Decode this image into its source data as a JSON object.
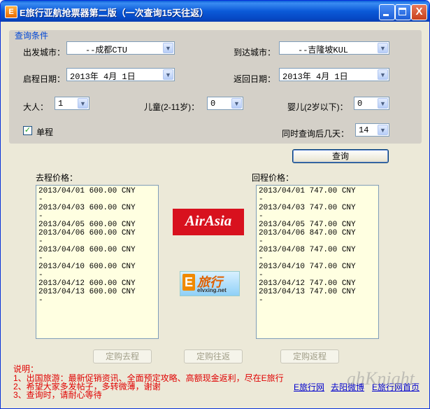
{
  "window": {
    "title": "E旅行亚航抢票器第二版（一次查询15天往返）",
    "icon_letter": "E",
    "close_glyph": "X"
  },
  "conditions": {
    "group_title": "查询条件",
    "depart_city_label": "出发城市：",
    "depart_city_value": "--成都CTU",
    "arrive_city_label": "到达城市：",
    "arrive_city_value": "--吉隆坡KUL",
    "depart_date_label": "启程日期：",
    "depart_date_value": "2013年 4月 1日",
    "return_date_label": "返回日期：",
    "return_date_value": "2013年 4月 1日",
    "adult_label": "大人：",
    "adult_value": "1",
    "child_label": "儿童(2-11岁)：",
    "child_value": "0",
    "infant_label": "婴儿(2岁以下)：",
    "infant_value": "0",
    "oneway_label": "单程",
    "oneway_checked": true,
    "days_label": "同时查询后几天：",
    "days_value": "14",
    "dropdown_glyph": "▼",
    "check_glyph": "✓"
  },
  "query_button": "查询",
  "outbound": {
    "label": "去程价格：",
    "lines": [
      "2013/04/01 600.00 CNY",
      "-",
      "2013/04/03 600.00 CNY",
      "-",
      "2013/04/05 600.00 CNY",
      "2013/04/06 600.00 CNY",
      "-",
      "2013/04/08 600.00 CNY",
      "-",
      "2013/04/10 600.00 CNY",
      "-",
      "2013/04/12 600.00 CNY",
      "2013/04/13 600.00 CNY",
      "-"
    ]
  },
  "inbound": {
    "label": "回程价格：",
    "lines": [
      "2013/04/01 747.00 CNY",
      "-",
      "2013/04/03 747.00 CNY",
      "-",
      "2013/04/05 747.00 CNY",
      "2013/04/06 847.00 CNY",
      "-",
      "2013/04/08 747.00 CNY",
      "-",
      "2013/04/10 747.00 CNY",
      "-",
      "2013/04/12 747.00 CNY",
      "2013/04/13 747.00 CNY",
      "-"
    ]
  },
  "logos": {
    "airasia": "AirAsia",
    "elvxing_mark": "E",
    "elvxing_cn": "旅行",
    "elvxing_url": "elvxing.net"
  },
  "buttons": {
    "book_outbound": "定购去程",
    "book_roundtrip": "定购往返",
    "book_return": "定购返程"
  },
  "notes": {
    "heading": "说明：",
    "line1": "1、出国旅游：最新促销资讯、全面预定攻略、高额现金返利，尽在E旅行",
    "line2": "2、希望大家多发帖子，多转微薄，谢谢",
    "line3": "3、查询时，请耐心等待"
  },
  "links": {
    "elvxing": "E旅行网",
    "weibo": "去阳微博",
    "ehome": "E旅行网首页"
  },
  "watermark": "ahKnight",
  "colors": {
    "title_bar": "#0b5ad8",
    "group_bg": "#d4d0c8",
    "price_bg": "#ffffe1",
    "note_red": "#e00000",
    "airasia_red": "#d8111e"
  }
}
